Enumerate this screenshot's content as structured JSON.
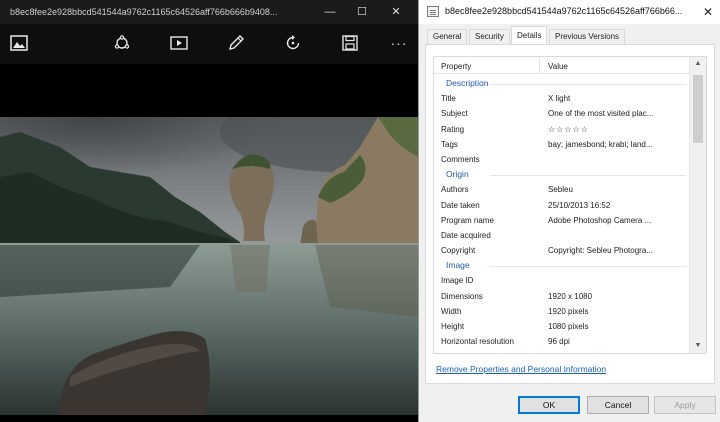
{
  "photos": {
    "title": "b8ec8fee2e928bbcd541544a9762c1165c64526aff766b666b9408...",
    "window_controls": {
      "minimize": "—",
      "maximize": "☐",
      "close": "✕"
    },
    "toolbar": {
      "icons": [
        "image-icon",
        "enhance-icon",
        "slideshow-icon",
        "edit-pencil-icon",
        "rotate-icon",
        "save-icon",
        "more-icon"
      ],
      "more_label": "···"
    }
  },
  "dialog": {
    "title": "b8ec8fee2e928bbcd541544a9762c1165c64526aff766b66...",
    "close": "✕",
    "tabs": [
      {
        "label": "General",
        "active": false
      },
      {
        "label": "Security",
        "active": false
      },
      {
        "label": "Details",
        "active": true
      },
      {
        "label": "Previous Versions",
        "active": false
      }
    ],
    "columns": {
      "property": "Property",
      "value": "Value"
    },
    "rows": [
      {
        "section": "Description"
      },
      {
        "property": "Title",
        "value": "X light"
      },
      {
        "property": "Subject",
        "value": "One of the most visited plac..."
      },
      {
        "property": "Rating",
        "value": "",
        "rating": 0
      },
      {
        "property": "Tags",
        "value": "bay; jamesbond; krabi; land..."
      },
      {
        "property": "Comments",
        "value": ""
      },
      {
        "section": "Origin"
      },
      {
        "property": "Authors",
        "value": "Sebleu"
      },
      {
        "property": "Date taken",
        "value": "25/10/2013 16:52"
      },
      {
        "property": "Program name",
        "value": "Adobe Photoshop Camera ..."
      },
      {
        "property": "Date acquired",
        "value": ""
      },
      {
        "property": "Copyright",
        "value": "Copyright: Sebleu Photogra..."
      },
      {
        "section": "Image"
      },
      {
        "property": "Image ID",
        "value": ""
      },
      {
        "property": "Dimensions",
        "value": "1920 x 1080"
      },
      {
        "property": "Width",
        "value": "1920 pixels"
      },
      {
        "property": "Height",
        "value": "1080 pixels"
      },
      {
        "property": "Horizontal resolution",
        "value": "96 dpi"
      }
    ],
    "remove_link": "Remove Properties and Personal Information",
    "buttons": {
      "ok": "OK",
      "cancel": "Cancel",
      "apply": "Apply"
    }
  },
  "colors": {
    "section_blue": "#1e5aa8",
    "link_blue": "#1a5fb4",
    "focus_blue": "#0078d7"
  }
}
